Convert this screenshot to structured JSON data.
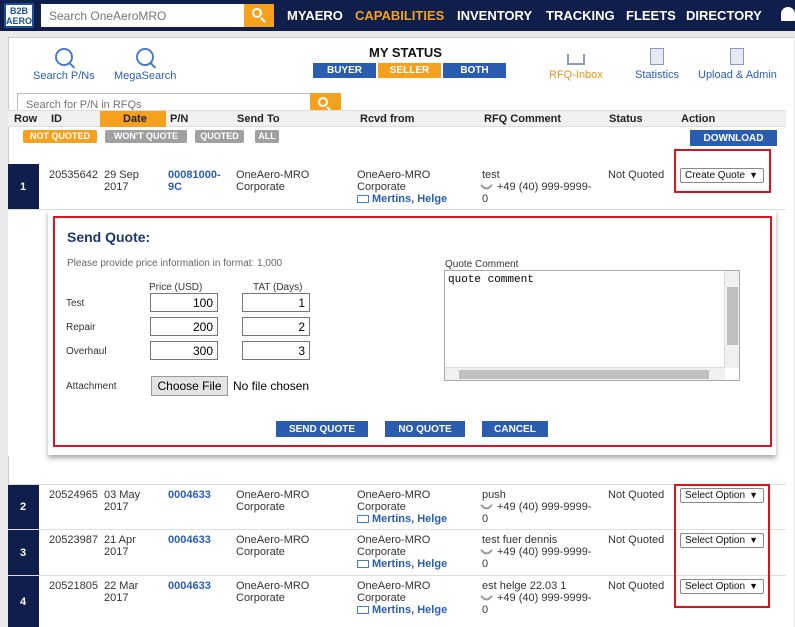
{
  "header": {
    "logo_top": "B2B",
    "logo_bottom": "AERO",
    "search_placeholder": "Search OneAeroMRO",
    "nav": [
      "MYAERO",
      "CAPABILITIES",
      "INVENTORY",
      "TRACKING",
      "FLEETS",
      "DIRECTORY"
    ],
    "active_nav": "CAPABILITIES"
  },
  "toolbar": {
    "search_pns": "Search P/Ns",
    "megasearch": "MegaSearch",
    "my_status_title": "MY STATUS",
    "status_buttons": [
      "BUYER",
      "SELLER",
      "BOTH"
    ],
    "selected_status": "SELLER",
    "rfq_inbox": "RFQ-Inbox",
    "statistics": "Statistics",
    "upload_admin": "Upload & Admin"
  },
  "rfq_search": {
    "placeholder": "Search for P/N in RFQs"
  },
  "filters": [
    "NOT QUOTED",
    "WON'T QUOTE",
    "QUOTED",
    "ALL"
  ],
  "active_filter": "NOT QUOTED",
  "download_label": "DOWNLOAD",
  "table": {
    "columns": [
      "Row",
      "ID",
      "Date",
      "P/N",
      "Send To",
      "Rcvd from",
      "RFQ Comment",
      "Status",
      "Action"
    ],
    "sorted_column": "Date",
    "rows": [
      {
        "row": "1",
        "id": "20535642",
        "date1": "29 Sep",
        "date2": "2017",
        "pn1": "00081000-",
        "pn2": "9C",
        "send1": "OneAero-MRO",
        "send2": "Corporate",
        "rcvd1": "OneAero-MRO",
        "rcvd2": "Corporate",
        "contact": "Mertins, Helge",
        "comment": "test",
        "phone": "+49 (40) 999-9999-",
        "phone2": "0",
        "status": "Not Quoted",
        "action": "Create Quote"
      },
      {
        "row": "2",
        "id": "20524965",
        "date1": "03 May",
        "date2": "2017",
        "pn1": "0004633",
        "pn2": "",
        "send1": "OneAero-MRO",
        "send2": "Corporate",
        "rcvd1": "OneAero-MRO",
        "rcvd2": "Corporate",
        "contact": "Mertins, Helge",
        "comment": "push",
        "phone": "+49 (40) 999-9999-",
        "phone2": "0",
        "status": "Not Quoted",
        "action": "Select Option"
      },
      {
        "row": "3",
        "id": "20523987",
        "date1": "21 Apr",
        "date2": "2017",
        "pn1": "0004633",
        "pn2": "",
        "send1": "OneAero-MRO",
        "send2": "Corporate",
        "rcvd1": "OneAero-MRO",
        "rcvd2": "Corporate",
        "contact": "Mertins, Helge",
        "comment": "test fuer dennis",
        "phone": "+49 (40) 999-9999-",
        "phone2": "0",
        "status": "Not Quoted",
        "action": "Select Option"
      },
      {
        "row": "4",
        "id": "20521805",
        "date1": "22 Mar",
        "date2": "2017",
        "pn1": "0004633",
        "pn2": "",
        "send1": "OneAero-MRO",
        "send2": "Corporate",
        "rcvd1": "OneAero-MRO",
        "rcvd2": "Corporate",
        "contact": "Mertins, Helge",
        "comment": "est helge 22.03 1",
        "phone": "+49 (40) 999-9999-",
        "phone2": "0",
        "status": "Not Quoted",
        "action": "Select Option"
      }
    ]
  },
  "send_quote": {
    "title": "Send Quote:",
    "hint": "Please provide price information in format: 1,000",
    "price_header": "Price (USD)",
    "tat_header": "TAT (Days)",
    "lines": [
      {
        "label": "Test",
        "price": "100",
        "tat": "1"
      },
      {
        "label": "Repair",
        "price": "200",
        "tat": "2"
      },
      {
        "label": "Overhaul",
        "price": "300",
        "tat": "3"
      }
    ],
    "attachment_label": "Attachment",
    "choose_file": "Choose File",
    "no_file": "No file chosen",
    "comment_label": "Quote Comment",
    "comment_value": "quote comment",
    "send_btn": "SEND QUOTE",
    "no_quote_btn": "NO QUOTE",
    "cancel_btn": "CANCEL"
  }
}
